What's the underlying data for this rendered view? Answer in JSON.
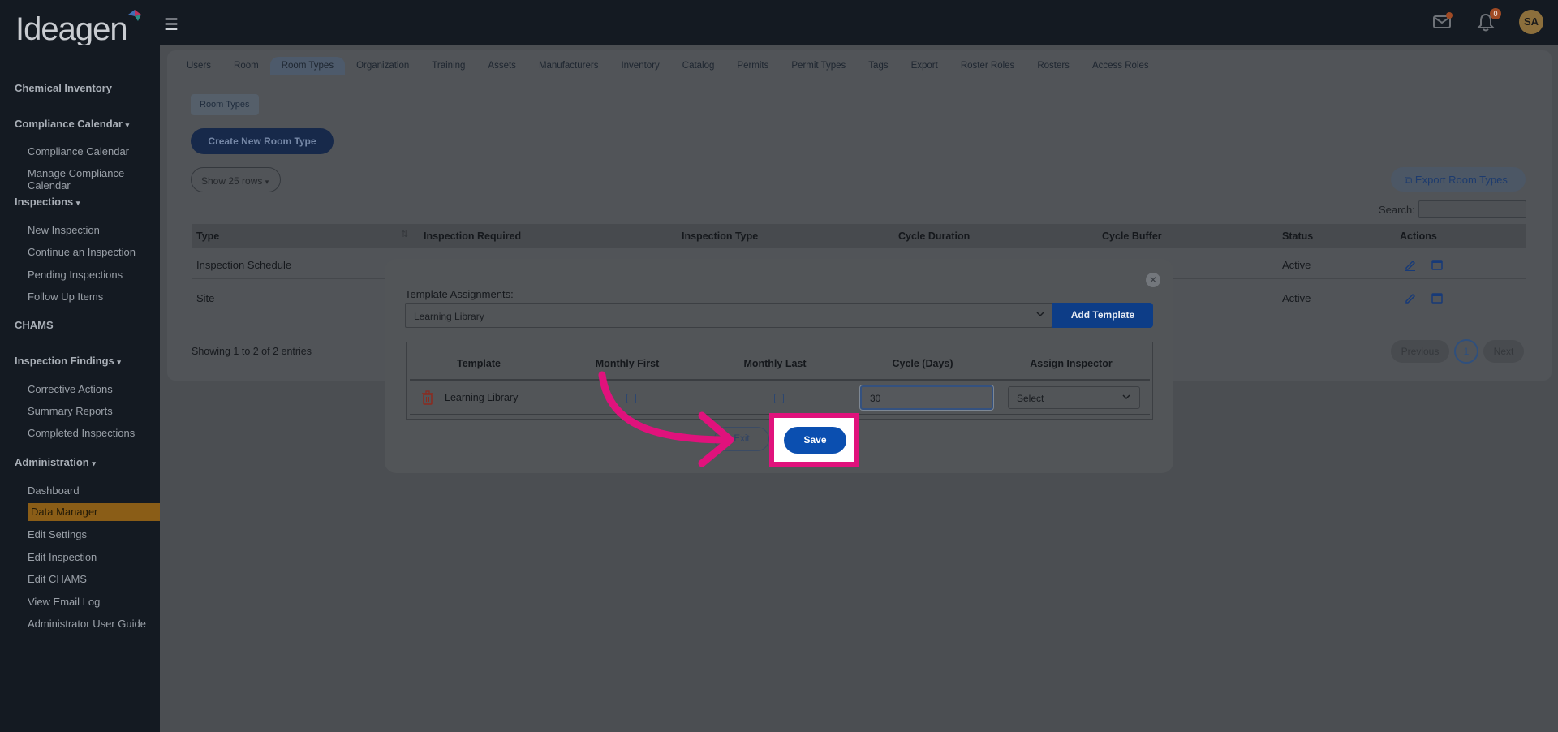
{
  "brand": {
    "logo_text": "Ideagen"
  },
  "topbar": {
    "notification_count": "0",
    "avatar_initials": "SA"
  },
  "sidebar": {
    "chemical_inventory": "Chemical Inventory",
    "compliance_calendar_section": "Compliance Calendar",
    "compliance_calendar": "Compliance Calendar",
    "manage_compliance_calendar": "Manage Compliance Calendar",
    "inspections_section": "Inspections",
    "new_inspection": "New Inspection",
    "continue_inspection": "Continue an Inspection",
    "pending_inspections": "Pending Inspections",
    "follow_up_items": "Follow Up Items",
    "chams": "CHAMS",
    "inspection_findings_section": "Inspection Findings",
    "corrective_actions": "Corrective Actions",
    "summary_reports": "Summary Reports",
    "completed_inspections": "Completed Inspections",
    "administration_section": "Administration",
    "dashboard": "Dashboard",
    "data_manager": "Data Manager",
    "edit_settings": "Edit Settings",
    "edit_inspection": "Edit Inspection",
    "edit_chams": "Edit CHAMS",
    "view_email_log": "View Email Log",
    "admin_user_guide": "Administrator User Guide"
  },
  "tabs": [
    "Users",
    "Room",
    "Room Types",
    "Organization",
    "Training",
    "Assets",
    "Manufacturers",
    "Inventory",
    "Catalog",
    "Permits",
    "Permit Types",
    "Tags",
    "Export",
    "Roster Roles",
    "Rosters",
    "Access Roles"
  ],
  "page": {
    "subpill": "Room Types",
    "create_button": "Create New Room Type",
    "show_rows": "Show 25 rows",
    "export_button": "Export Room Types",
    "search_label": "Search:",
    "entries_text": "Showing 1 to 2 of 2 entries",
    "pagination": {
      "previous": "Previous",
      "page": "1",
      "next": "Next"
    }
  },
  "table": {
    "headers": {
      "type": "Type",
      "inspection_required": "Inspection Required",
      "inspection_type": "Inspection Type",
      "cycle_duration": "Cycle Duration",
      "cycle_buffer": "Cycle Buffer",
      "status": "Status",
      "actions": "Actions"
    },
    "rows": [
      {
        "type": "Inspection Schedule",
        "status": "Active"
      },
      {
        "type": "Site",
        "status": "Active"
      }
    ]
  },
  "modal": {
    "template_assignments_label": "Template Assignments:",
    "selected_template": "Learning Library",
    "add_template_button": "Add Template",
    "columns": {
      "template": "Template",
      "monthly_first": "Monthly First",
      "monthly_last": "Monthly Last",
      "cycle_days": "Cycle (Days)",
      "assign_inspector": "Assign Inspector"
    },
    "row": {
      "template": "Learning Library",
      "monthly_first": false,
      "monthly_last": false,
      "cycle_days": "30",
      "assign_inspector": "Select"
    },
    "exit_button": "Exit",
    "save_button": "Save"
  },
  "annotation": {
    "highlight_color": "#e0127c"
  }
}
